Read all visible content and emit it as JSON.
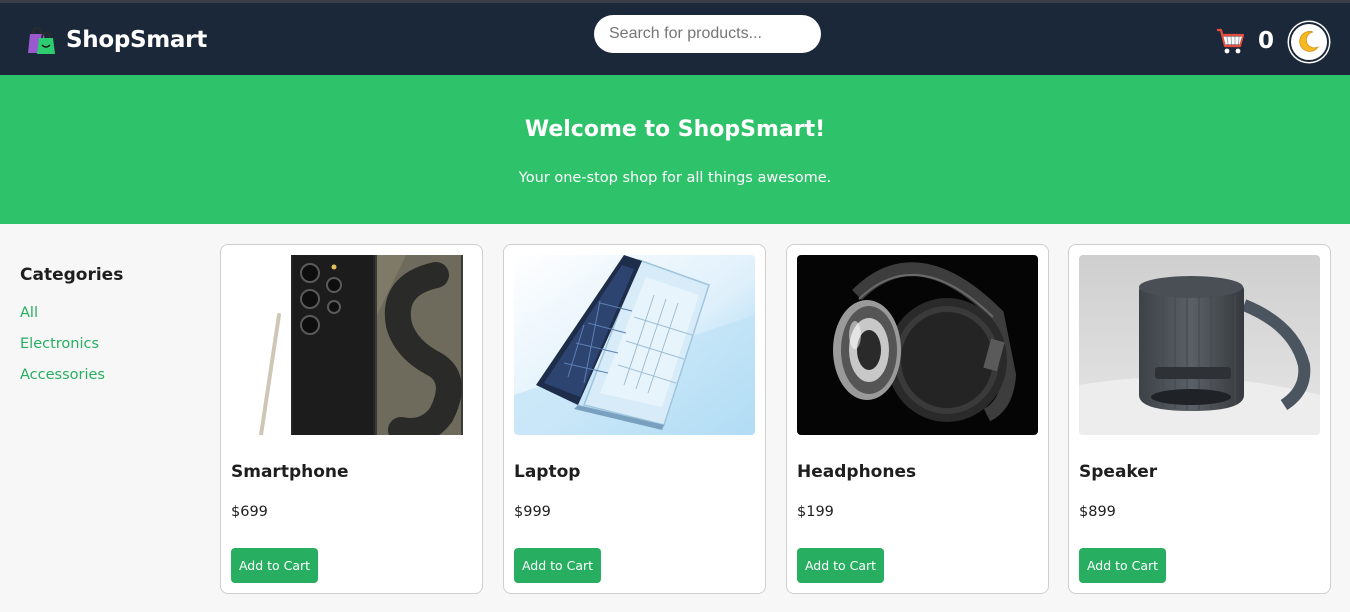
{
  "header": {
    "brand_name": "ShopSmart",
    "brand_icon": "shopping-bags-icon",
    "search_placeholder": "Search for products...",
    "search_value": "",
    "cart_icon": "shopping-cart-icon",
    "cart_count": "0",
    "theme_icon": "crescent-moon-icon"
  },
  "hero": {
    "title": "Welcome to ShopSmart!",
    "subtitle": "Your one-stop shop for all things awesome."
  },
  "sidebar": {
    "heading": "Categories",
    "categories": [
      "All",
      "Electronics",
      "Accessories"
    ]
  },
  "products": [
    {
      "name": "Smartphone",
      "price": "$699",
      "button": "Add to Cart",
      "image": "smartphone-image"
    },
    {
      "name": "Laptop",
      "price": "$999",
      "button": "Add to Cart",
      "image": "laptop-image"
    },
    {
      "name": "Headphones",
      "price": "$199",
      "button": "Add to Cart",
      "image": "headphones-image"
    },
    {
      "name": "Speaker",
      "price": "$899",
      "button": "Add to Cart",
      "image": "speaker-image"
    }
  ],
  "colors": {
    "header_bg": "#1b2839",
    "hero_bg": "#2ec36b",
    "accent_green": "#27ae60",
    "page_bg": "#f7f7f7"
  }
}
